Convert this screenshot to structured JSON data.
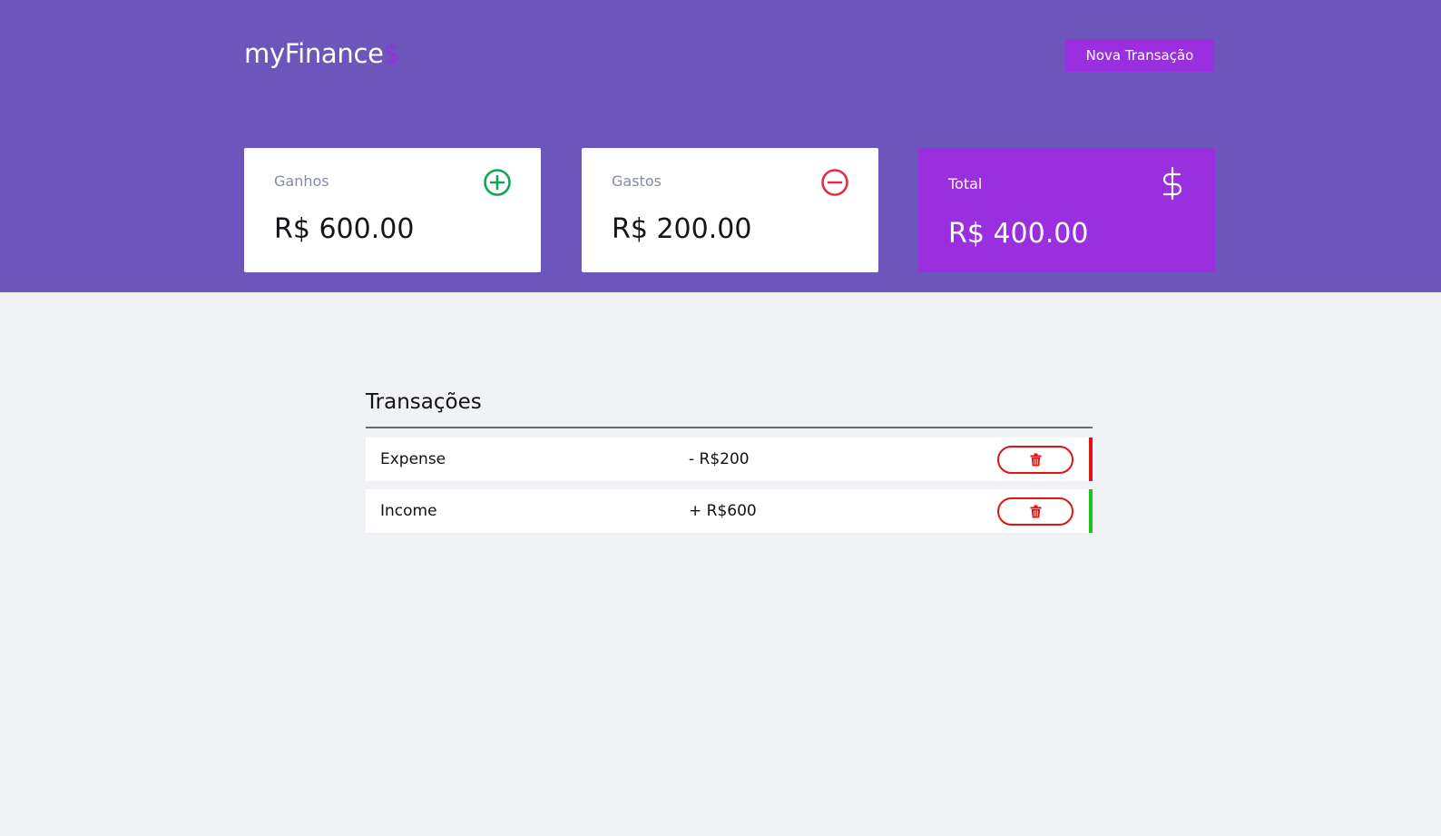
{
  "header": {
    "logo_text": "myFinance",
    "logo_accent": "$",
    "new_transaction_label": "Nova Transação"
  },
  "summary": {
    "income": {
      "label": "Ganhos",
      "value": "R$ 600.00",
      "icon": "plus-circle-icon"
    },
    "expense": {
      "label": "Gastos",
      "value": "R$ 200.00",
      "icon": "minus-circle-icon"
    },
    "total": {
      "label": "Total",
      "value": "R$ 400.00",
      "icon": "dollar-icon"
    }
  },
  "transactions": {
    "title": "Transações",
    "rows": [
      {
        "name": "Expense",
        "amount": "- R$200",
        "type": "expense",
        "action_icon": "trash-icon"
      },
      {
        "name": "Income",
        "amount": "+ R$600",
        "type": "income",
        "action_icon": "trash-icon"
      }
    ]
  },
  "colors": {
    "header_bg": "#6c55bb",
    "accent": "#9a2fe0",
    "income": "#1bc41b",
    "expense": "#e01414",
    "page_bg": "#f0f2f5"
  }
}
